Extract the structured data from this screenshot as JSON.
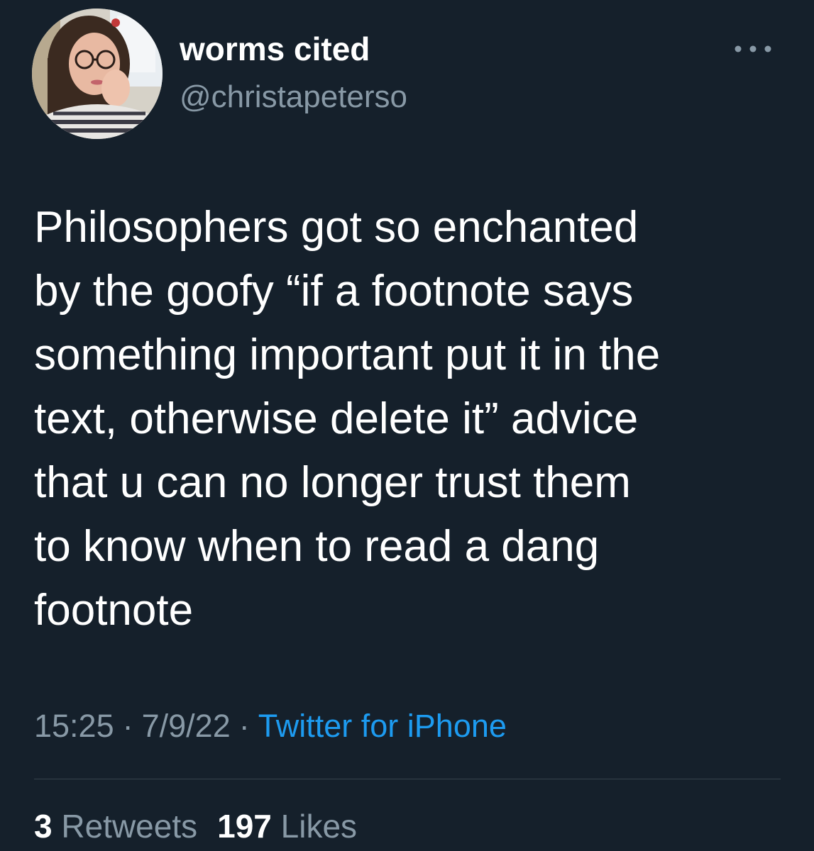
{
  "author": {
    "display_name": "worms cited",
    "handle": "@christapeterso",
    "avatar_icon": "profile-photo"
  },
  "tweet": {
    "text": "Philosophers got so enchanted\nby the goofy “if a footnote says\nsomething important put it in the\ntext, otherwise delete it” advice\nthat u can no longer trust them\nto know when to read a dang\nfootnote",
    "time": "15:25",
    "date": "7/9/22",
    "separator": "·",
    "source": "Twitter for iPhone"
  },
  "stats": {
    "retweets_count": "3",
    "retweets_label": "Retweets",
    "likes_count": "197",
    "likes_label": "Likes"
  },
  "colors": {
    "background": "#15202b",
    "primary_text": "#ffffff",
    "secondary_text": "#8899a6",
    "link": "#1d9bf0",
    "divider": "#38444d"
  },
  "icons": {
    "more": "more-horizontal-icon"
  }
}
